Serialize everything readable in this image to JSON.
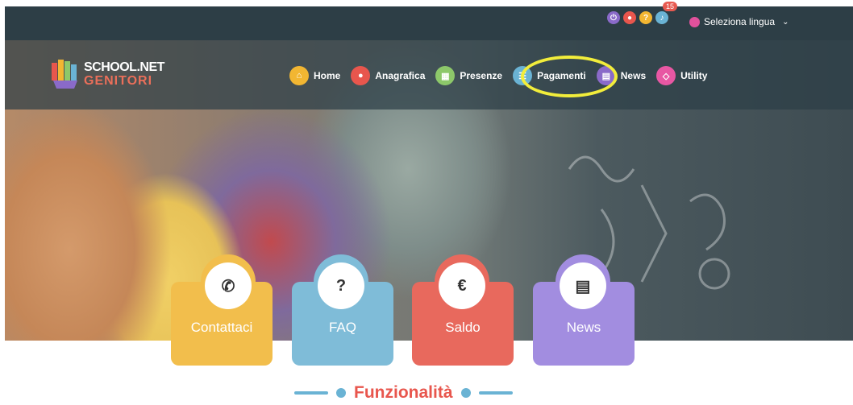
{
  "top_bar": {
    "icons": [
      {
        "name": "power-icon",
        "color": "#8a6ac9",
        "glyph": "⏻"
      },
      {
        "name": "user-icon",
        "color": "#e8564d",
        "glyph": "●"
      },
      {
        "name": "help-icon",
        "color": "#f2b632",
        "glyph": "?"
      },
      {
        "name": "notifications-icon",
        "color": "#6ab3d4",
        "glyph": "♪"
      }
    ],
    "notifications_count": "15",
    "language_label": "Seleziona lingua"
  },
  "logo": {
    "line1": "SCHOOL.NET",
    "line2": "GENITORI"
  },
  "nav": {
    "items": [
      {
        "label": "Home",
        "color": "#f2b632",
        "glyph": "⌂"
      },
      {
        "label": "Anagrafica",
        "color": "#e8564d",
        "glyph": "●"
      },
      {
        "label": "Presenze",
        "color": "#8dc86a",
        "glyph": "▦"
      },
      {
        "label": "Pagamenti",
        "color": "#6ab3d4",
        "glyph": "☰"
      },
      {
        "label": "News",
        "color": "#8a6ac9",
        "glyph": "▤"
      },
      {
        "label": "Utility",
        "color": "#e857a3",
        "glyph": "◇"
      }
    ]
  },
  "cards": [
    {
      "label": "Contattaci",
      "color": "#f2be4c",
      "glyph": "✆"
    },
    {
      "label": "FAQ",
      "color": "#7fbcd8",
      "glyph": "?"
    },
    {
      "label": "Saldo",
      "color": "#e8695d",
      "glyph": "€"
    },
    {
      "label": "News",
      "color": "#a28de0",
      "glyph": "▤"
    }
  ],
  "section_title": "Funzionalità"
}
